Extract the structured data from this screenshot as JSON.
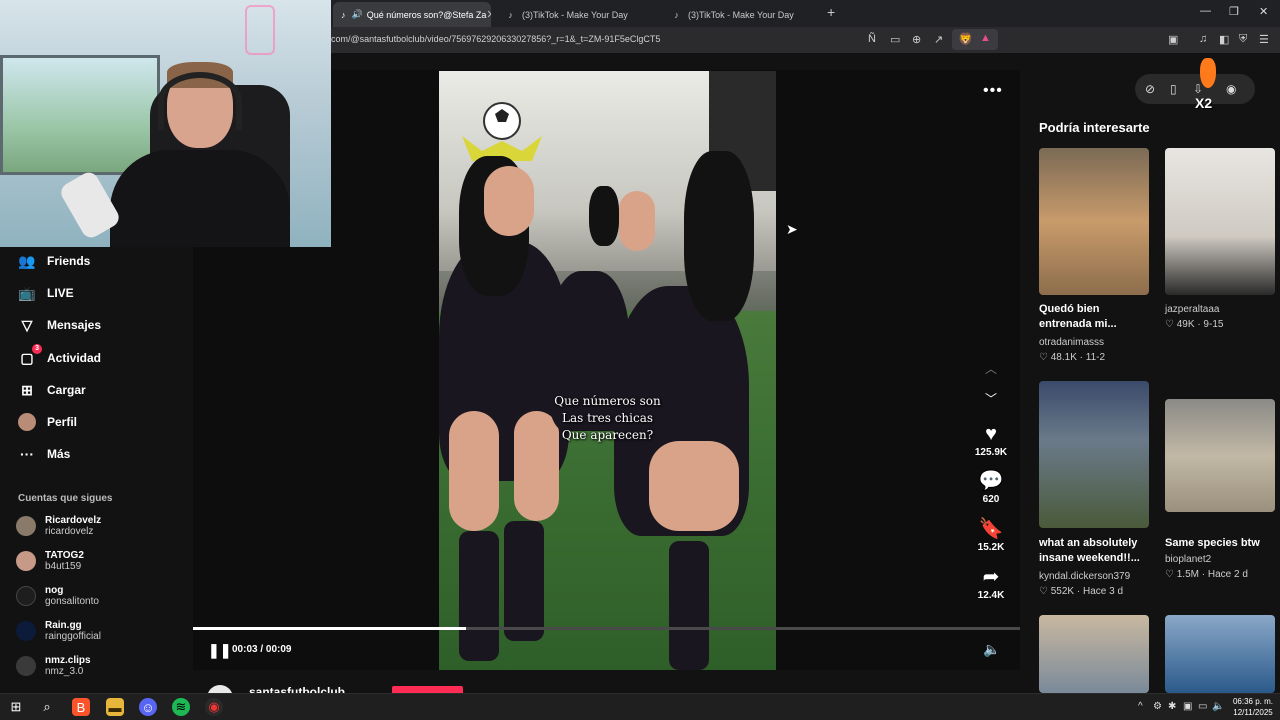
{
  "browser": {
    "tabs": [
      {
        "label": "Qué números son?@Stefa Za"
      },
      {
        "label": "(3)TikTok - Make Your Day"
      },
      {
        "label": "(3)TikTok - Make Your Day"
      }
    ],
    "url": "com/@santasfutbolclub/video/7569762920633027856?_r=1&_t=ZM-91F5eClgCT5"
  },
  "sidebar": {
    "items": [
      {
        "label": "Friends",
        "icon": "friends-icon"
      },
      {
        "label": "LIVE",
        "icon": "live-icon"
      },
      {
        "label": "Mensajes",
        "icon": "messages-icon"
      },
      {
        "label": "Actividad",
        "icon": "activity-icon",
        "badge": "3"
      },
      {
        "label": "Cargar",
        "icon": "upload-icon"
      },
      {
        "label": "Perfil",
        "icon": "profile-icon"
      },
      {
        "label": "Más",
        "icon": "more-icon"
      }
    ],
    "following_title": "Cuentas que sigues",
    "following": [
      {
        "name": "Ricardovelz",
        "handle": "ricardovelz"
      },
      {
        "name": "TATOG2",
        "handle": "b4ut159"
      },
      {
        "name": "nog",
        "handle": "gonsalitonto"
      },
      {
        "name": "Rain.gg",
        "handle": "rainggofficial"
      },
      {
        "name": "nmz.clips",
        "handle": "nmz_3.0"
      }
    ]
  },
  "video": {
    "caption_lines": [
      "Que números son",
      "Las tres chicas",
      "Que aparecen?"
    ],
    "time": "00:03 / 00:09",
    "progress": 0.33,
    "likes": "125.9K",
    "comments": "620",
    "saves": "15.2K",
    "shares": "12.4K",
    "author": "santasfutbolclub"
  },
  "recommendations": {
    "title": "Podría interesarte",
    "cards": [
      {
        "title": "Quedó bien entrenada mi...",
        "author": "otradanimasss",
        "stats": "♡ 48.1K · 11-2"
      },
      {
        "title": "",
        "author": "jazperaltaaa",
        "stats": "♡ 49K · 9-15"
      },
      {
        "title": "what an absolutely insane weekend!!...",
        "author": "kyndal.dickerson379",
        "stats": "♡ 552K · Hace 3 d"
      },
      {
        "title": "Same species btw",
        "author": "bioplanet2",
        "stats": "♡ 1.5M · Hace 2 d"
      }
    ],
    "overlay_x2": "X2"
  },
  "taskbar": {
    "clock_time": "06:36 p. m.",
    "clock_date": "12/11/2025"
  },
  "colors": {
    "accent": "#fe2c55",
    "background": "#121212"
  }
}
